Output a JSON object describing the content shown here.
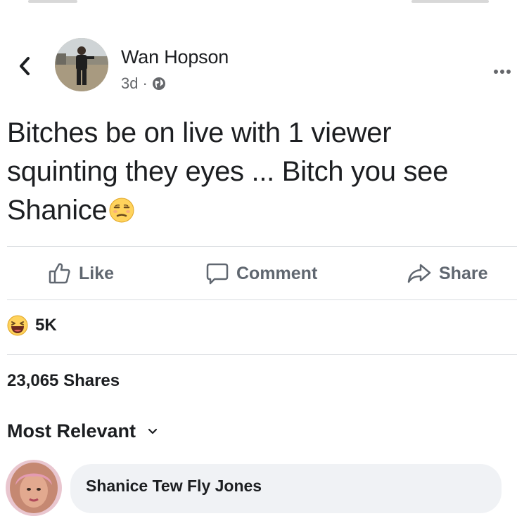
{
  "post": {
    "author": "Wan Hopson",
    "time": "3d",
    "separator": "·",
    "privacy_icon": "globe-icon",
    "text": "Bitches be on live with 1 viewer squinting they eyes ... Bitch you see Shanice",
    "trailing_emoji": "unamused-face-icon"
  },
  "actions": {
    "like_label": "Like",
    "comment_label": "Comment",
    "share_label": "Share"
  },
  "stats": {
    "reaction_icon": "haha-reaction-icon",
    "reaction_count": "5K",
    "shares": "23,065 Shares"
  },
  "comments": {
    "sort_label": "Most Relevant",
    "first_author": "Shanice Tew Fly Jones"
  },
  "colors": {
    "text": "#1c1e21",
    "secondary": "#65676b",
    "action": "#606770",
    "divider": "#dadde1",
    "bubble": "#f0f2f5",
    "emoji_yellow": "#ffd35c"
  }
}
